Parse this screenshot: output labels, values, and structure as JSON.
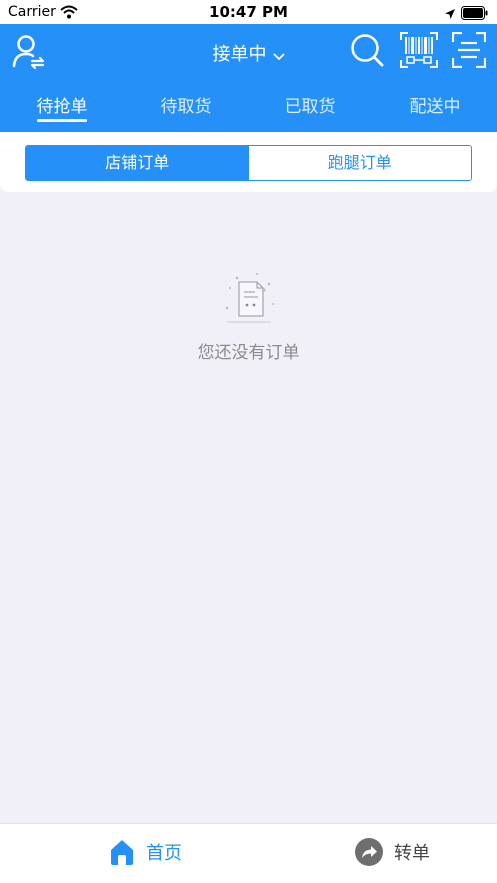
{
  "status_bar": {
    "carrier": "Carrier",
    "time": "10:47 PM"
  },
  "header": {
    "title": "接单中",
    "icons": [
      "user-switch-icon",
      "chevron-down-icon",
      "search-icon",
      "barcode-icon",
      "scan-icon"
    ]
  },
  "tabs": [
    {
      "label": "待抢单",
      "active": true
    },
    {
      "label": "待取货",
      "active": false
    },
    {
      "label": "已取货",
      "active": false
    },
    {
      "label": "配送中",
      "active": false
    }
  ],
  "segment": {
    "items": [
      {
        "label": "店铺订单",
        "active": true
      },
      {
        "label": "跑腿订单",
        "active": false
      }
    ]
  },
  "empty_state": {
    "message": "您还没有订单"
  },
  "bottom_nav": {
    "home_label": "首页",
    "transfer_label": "转单"
  },
  "colors": {
    "primary": "#2590f8",
    "background": "#f1f0f8",
    "muted_text": "#8b8b8b"
  }
}
